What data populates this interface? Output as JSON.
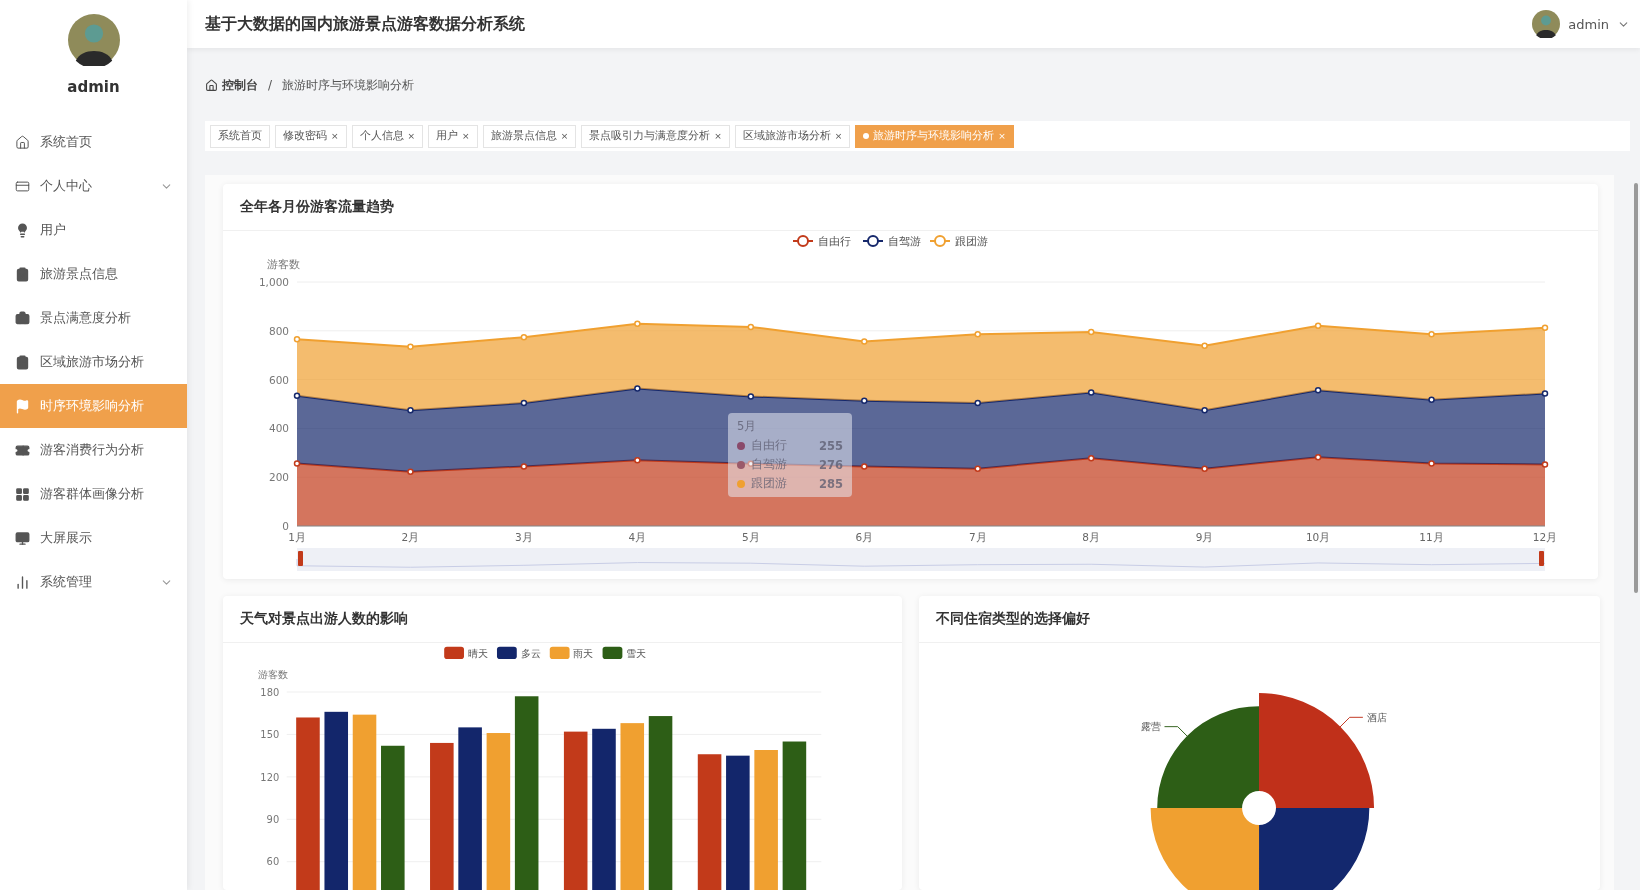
{
  "sidebar": {
    "user": {
      "name": "admin"
    },
    "items": [
      {
        "label": "系统首页",
        "selected": false,
        "has_submenu": false
      },
      {
        "label": "个人中心",
        "selected": false,
        "has_submenu": true
      },
      {
        "label": "用户",
        "selected": false,
        "has_submenu": false
      },
      {
        "label": "旅游景点信息",
        "selected": false,
        "has_submenu": false
      },
      {
        "label": "景点满意度分析",
        "selected": false,
        "has_submenu": false
      },
      {
        "label": "区域旅游市场分析",
        "selected": false,
        "has_submenu": false
      },
      {
        "label": "时序环境影响分析",
        "selected": true,
        "has_submenu": false
      },
      {
        "label": "游客消费行为分析",
        "selected": false,
        "has_submenu": false
      },
      {
        "label": "游客群体画像分析",
        "selected": false,
        "has_submenu": false
      },
      {
        "label": "大屏展示",
        "selected": false,
        "has_submenu": false
      },
      {
        "label": "系统管理",
        "selected": false,
        "has_submenu": true
      }
    ]
  },
  "header": {
    "title": "基于大数据的国内旅游景点游客数据分析系统",
    "user": "admin"
  },
  "breadcrumb": {
    "home": "控制台",
    "separator": "/",
    "current": "旅游时序与环境影响分析"
  },
  "tabs": [
    {
      "label": "系统首页",
      "selected": false
    },
    {
      "label": "修改密码",
      "selected": false,
      "close": "×"
    },
    {
      "label": "个人信息",
      "selected": false,
      "close": "×"
    },
    {
      "label": "用户",
      "selected": false,
      "close": "×"
    },
    {
      "label": "旅游景点信息",
      "selected": false,
      "close": "×"
    },
    {
      "label": "景点吸引力与满意度分析",
      "selected": false,
      "close": "×"
    },
    {
      "label": "区域旅游市场分析",
      "selected": false,
      "close": "×"
    },
    {
      "label": "旅游时序与环境影响分析",
      "selected": true,
      "close": "×"
    }
  ],
  "trend_card": {
    "title": "全年各月份游客流量趋势",
    "chart_data": {
      "type": "area",
      "stacked": true,
      "legend": true,
      "grid": true,
      "ylabel": "游客数",
      "ylim": [
        0,
        1000
      ],
      "yticks": [
        0,
        200,
        400,
        600,
        800,
        {
          "value": 1000,
          "label": "1,000"
        }
      ],
      "categories": [
        "1月",
        "2月",
        "3月",
        "4月",
        "5月",
        "6月",
        "7月",
        "8月",
        "9月",
        "10月",
        "11月",
        "12月"
      ],
      "series": [
        {
          "name": "自由行",
          "color": "#c23a1a",
          "values": [
            256,
            222,
            244,
            269,
            255,
            244,
            235,
            278,
            235,
            282,
            256,
            252
          ]
        },
        {
          "name": "自驾游",
          "color": "#16286b",
          "values": [
            278,
            252,
            260,
            295,
            276,
            269,
            269,
            269,
            239,
            274,
            261,
            291
          ]
        },
        {
          "name": "跟团游",
          "color": "#f0a030",
          "values": [
            231,
            261,
            270,
            265,
            285,
            243,
            282,
            248,
            265,
            265,
            269,
            269
          ]
        }
      ]
    },
    "tooltip": {
      "title": "5月",
      "rows": [
        {
          "name": "自由行",
          "value": "255",
          "color": "#8a4a6a"
        },
        {
          "name": "自驾游",
          "value": "276",
          "color": "#9a5a6a"
        },
        {
          "name": "跟团游",
          "value": "285",
          "color": "#f0a030"
        }
      ]
    }
  },
  "weather_card": {
    "title": "天气对景点出游人数的影响",
    "chart_data": {
      "type": "bar",
      "stacked": false,
      "legend": true,
      "grid": true,
      "ylabel": "游客数",
      "ylim": [
        40,
        180
      ],
      "yticks": [
        60,
        90,
        120,
        150,
        180
      ],
      "series": [
        {
          "name": "晴天",
          "color": "#c23a1a",
          "values": [
            162,
            144,
            152,
            136
          ]
        },
        {
          "name": "多云",
          "color": "#13266b",
          "values": [
            166,
            155,
            154,
            135
          ]
        },
        {
          "name": "雨天",
          "color": "#f0a030",
          "values": [
            164,
            151,
            158,
            139
          ]
        },
        {
          "name": "雪天",
          "color": "#2d5e16",
          "values": [
            142,
            177,
            163,
            145
          ]
        }
      ]
    }
  },
  "lodging_card": {
    "title": "不同住宿类型的选择偏好",
    "slices": [
      {
        "label": "酒店",
        "color": "#c0301a"
      },
      {
        "color": "#13286e"
      },
      {
        "color": "#f0a030"
      },
      {
        "label": "露营",
        "color": "#2d5e16"
      }
    ]
  }
}
